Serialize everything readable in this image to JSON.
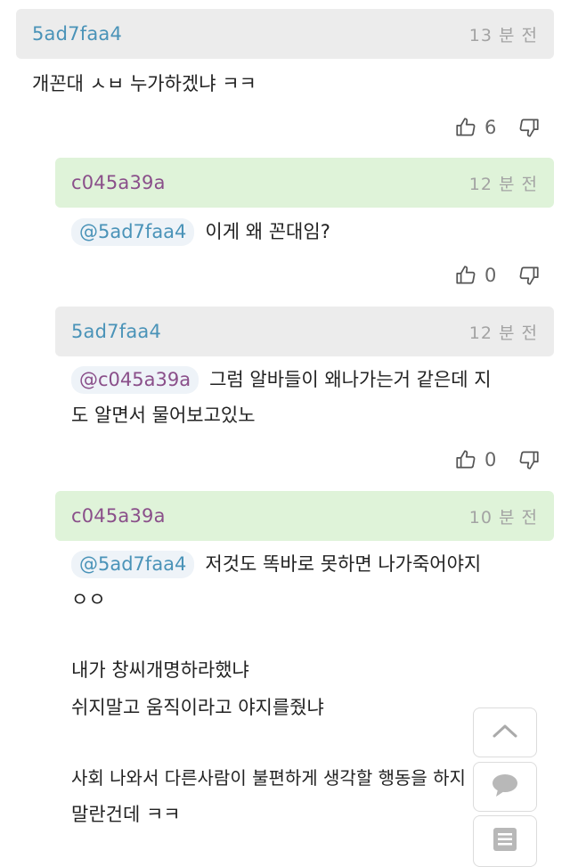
{
  "comments": [
    {
      "author": "5ad7faa4",
      "time": "13 분 전",
      "lines": [
        "개꼰대 ㅅㅂ 누가하겠냐 ㅋㅋ"
      ],
      "likes": "6"
    },
    {
      "author": "c045a39a",
      "time": "12 분 전",
      "mention": "@5ad7faa4",
      "lines": [
        "이게 왜 꼰대임?"
      ],
      "likes": "0"
    },
    {
      "author": "5ad7faa4",
      "time": "12 분 전",
      "mention": "@c045a39a",
      "lines": [
        "그럼 알바들이 왜나가는거 같은데 지",
        "도 알면서 물어보고있노"
      ],
      "likes": "0"
    },
    {
      "author": "c045a39a",
      "time": "10 분 전",
      "mention": "@5ad7faa4",
      "lines": [
        "저것도 똑바로 못하면 나가죽어야지",
        "ㅇㅇ",
        "내가 창씨개명하라했냐",
        "쉬지말고 움직이라고 야지를줬냐",
        "사회 나와서 다른사람이 불편하게 생각할 행동을 하지",
        "말란건데 ㅋㅋ"
      ]
    }
  ],
  "icons": {
    "like": "thumbs-up-icon",
    "dislike": "thumbs-down-icon",
    "scroll_top": "chevron-up-icon",
    "chat": "chat-bubble-icon",
    "list": "list-icon"
  },
  "colors": {
    "author_a": "#4a93b8",
    "author_b": "#8a4f8a",
    "header_gray": "#ececec",
    "header_green": "#dff3d9"
  }
}
